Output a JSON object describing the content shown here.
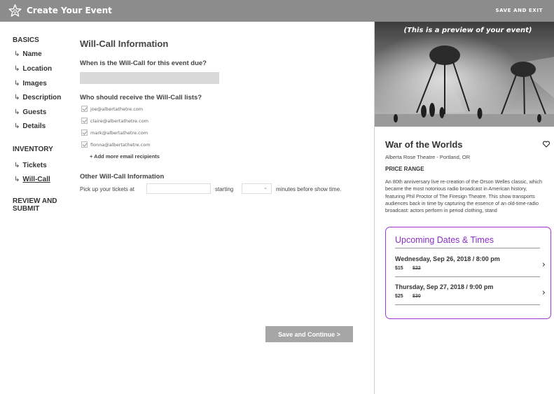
{
  "header": {
    "title": "Create Your Event",
    "save_exit": "SAVE AND EXIT"
  },
  "sidebar": {
    "basics_heading": "BASICS",
    "basics_items": [
      "Name",
      "Location",
      "Images",
      "Description",
      "Guests",
      "Details"
    ],
    "inventory_heading": "INVENTORY",
    "inventory_items": [
      "Tickets",
      "Will-Call"
    ],
    "active_item": "Will-Call",
    "review_heading_line1": "REVIEW AND",
    "review_heading_line2": "SUBMIT",
    "arrow_glyph": "↳"
  },
  "form": {
    "title": "Will-Call Information",
    "due_question": "When is the Will-Call for this event due?",
    "due_value": "",
    "recipients_question": "Who should receive the Will-Call lists?",
    "recipients": [
      {
        "email": "joe@albertathetre.com",
        "checked": true
      },
      {
        "email": "claire@albertathetre.com",
        "checked": true
      },
      {
        "email": "mark@albertathetre.com",
        "checked": true
      },
      {
        "email": "fionna@albertathetre.com",
        "checked": true
      }
    ],
    "add_more": "+ Add more email recipients",
    "other_title": "Other Will-Call Information",
    "pickup_label": "Pick up your tickets at",
    "pickup_value": "",
    "starting_label": "starting",
    "minutes_value": "",
    "minutes_label": "minutes before show time.",
    "save_button": "Save and Continue >"
  },
  "preview": {
    "note": "(This is a preview of your event)",
    "event_title": "War of the Worlds",
    "venue": "Alberta Rose Theatre - Portland, OR",
    "price_range_label": "PRICE RANGE",
    "description": "An 80th anniversary live re-creation of the Orson Welles classic, which became the most notorious radio broadcast in American history, featuring Phil Proctor of The Firesign Theatre. This show transports audiences back in time by capturing the essence of an old-time-radio broadcast: actors perform in period clothing, stand",
    "dates_title": "Upcoming Dates & Times",
    "dates": [
      {
        "datetime": "Wednesday, Sep 26, 2018 / 8:00 pm",
        "price": "$15",
        "old_price": "$22"
      },
      {
        "datetime": "Thursday, Sep 27, 2018 / 9:00 pm",
        "price": "$25",
        "old_price": "$30"
      }
    ],
    "accent_color": "#8b2fc9"
  }
}
